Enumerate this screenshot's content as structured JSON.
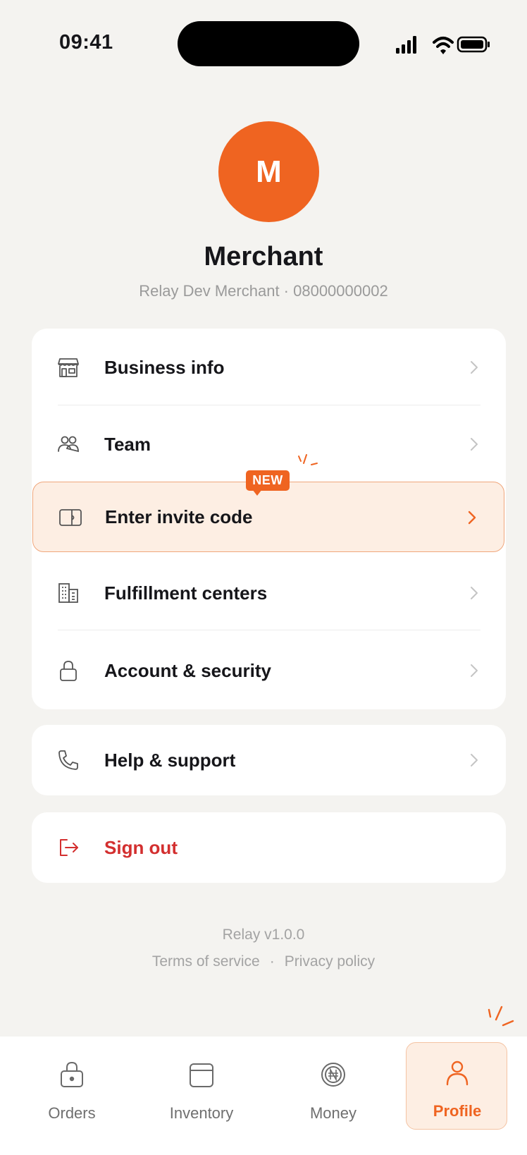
{
  "status_bar": {
    "time": "09:41"
  },
  "profile": {
    "avatar_initial": "M",
    "name": "Merchant",
    "subtitle": "Relay Dev Merchant · 08000000002"
  },
  "menu": {
    "items": [
      {
        "label": "Business info",
        "icon": "storefront-icon"
      },
      {
        "label": "Team",
        "icon": "team-icon"
      },
      {
        "label": "Enter invite code",
        "icon": "ticket-icon",
        "badge": "NEW"
      },
      {
        "label": "Fulfillment centers",
        "icon": "building-icon"
      },
      {
        "label": "Account & security",
        "icon": "lock-icon"
      }
    ],
    "help": {
      "label": "Help & support",
      "icon": "phone-icon"
    },
    "signout": {
      "label": "Sign out",
      "icon": "logout-icon"
    }
  },
  "footer": {
    "version": "Relay v1.0.0",
    "terms": "Terms of service",
    "separator": "·",
    "privacy": "Privacy policy"
  },
  "tabbar": {
    "tabs": [
      {
        "label": "Orders",
        "icon": "lock-bag-icon"
      },
      {
        "label": "Inventory",
        "icon": "box-icon"
      },
      {
        "label": "Money",
        "icon": "naira-coin-icon"
      },
      {
        "label": "Profile",
        "icon": "person-icon",
        "active": true
      }
    ]
  },
  "colors": {
    "accent": "#ef6421",
    "danger": "#d32f2f",
    "background": "#f4f3f0",
    "highlight": "#fdeee3"
  }
}
